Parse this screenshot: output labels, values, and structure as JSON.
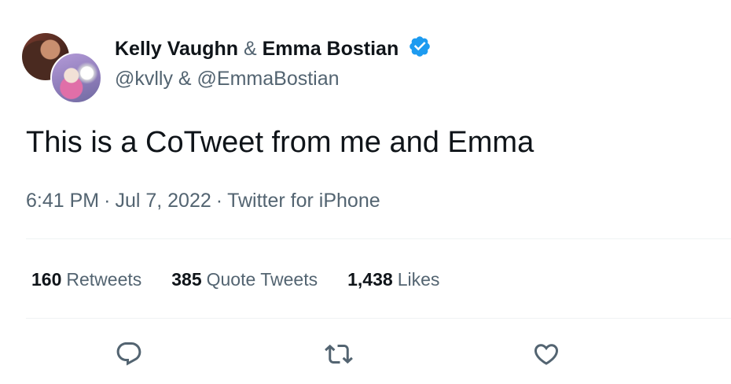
{
  "authors": {
    "primary_name": "Kelly Vaughn",
    "separator": "&",
    "secondary_name": "Emma Bostian",
    "verified": true,
    "handles": "@kvlly & @EmmaBostian"
  },
  "tweet": {
    "text": "This is a CoTweet from me and Emma"
  },
  "meta": {
    "time": "6:41 PM",
    "dot_1": "·",
    "date": "Jul 7, 2022",
    "dot_2": "·",
    "source": "Twitter for iPhone"
  },
  "stats": {
    "retweets_count": "160",
    "retweets_label": "Retweets",
    "quotes_count": "385",
    "quotes_label": "Quote Tweets",
    "likes_count": "1,438",
    "likes_label": "Likes"
  },
  "icons": {
    "verified": "verified-badge-icon",
    "reply": "reply-icon",
    "retweet": "retweet-icon",
    "like": "heart-icon"
  },
  "colors": {
    "text_primary": "#0f1419",
    "text_secondary": "#536471",
    "verified_blue": "#1d9bf0",
    "divider": "#eff3f4"
  }
}
